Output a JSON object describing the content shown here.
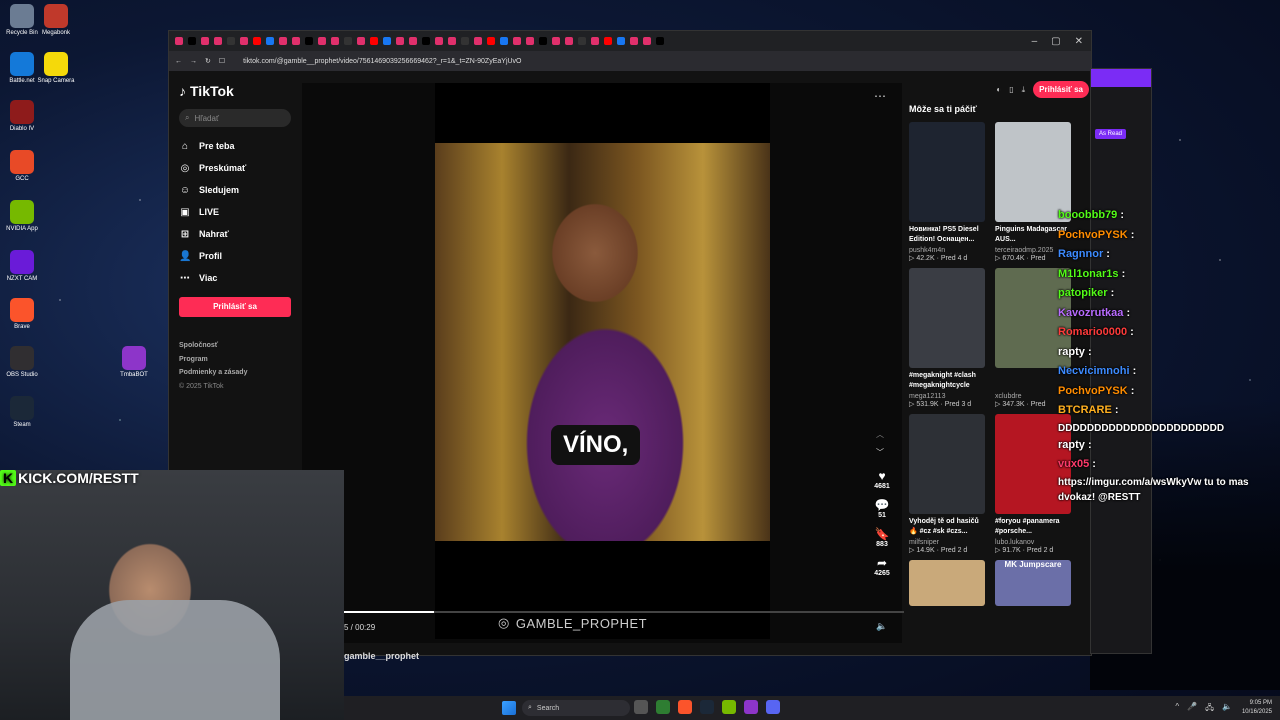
{
  "desktop": {
    "icons": [
      {
        "label": "Recycle Bin",
        "icon": "recycle-bin-icon",
        "color": "#6b7c93"
      },
      {
        "label": "Megabonk",
        "icon": "megabonk-icon",
        "color": "#c0392b"
      },
      {
        "label": "Battle.net",
        "icon": "battlenet-icon",
        "color": "#1479d9"
      },
      {
        "label": "Snap Camera",
        "icon": "snap-camera-icon",
        "color": "#f5d90a"
      },
      {
        "label": "Diablo IV",
        "icon": "diablo-icon",
        "color": "#8e1b1b"
      },
      {
        "label": "GCC",
        "icon": "gcc-icon",
        "color": "#e84a27"
      },
      {
        "label": "NVIDIA App",
        "icon": "nvidia-icon",
        "color": "#76b900"
      },
      {
        "label": "NZXT CAM",
        "icon": "nzxt-icon",
        "color": "#6a1bd8"
      },
      {
        "label": "Brave",
        "icon": "brave-icon",
        "color": "#fb542b"
      },
      {
        "label": "OBS Studio",
        "icon": "obs-icon",
        "color": "#302e31"
      },
      {
        "label": "Steam",
        "icon": "steam-icon",
        "color": "#1b2838"
      },
      {
        "label": "TmbaBOT",
        "icon": "tmbabot-icon",
        "color": "#8d35c9"
      }
    ]
  },
  "browser": {
    "url": "tiktok.com/@gamble__prophet/video/7561469039256669462?_r=1&_t=ZN-90ZyEaYjUvO",
    "window_controls": [
      "–",
      "▢",
      "✕"
    ]
  },
  "tiktok": {
    "brand": "TikTok",
    "search_placeholder": "Hľadať",
    "nav": [
      {
        "label": "Pre teba",
        "icon": "home-icon",
        "glyph": "⌂"
      },
      {
        "label": "Preskúmať",
        "icon": "compass-icon",
        "glyph": "◎"
      },
      {
        "label": "Sledujem",
        "icon": "following-icon",
        "glyph": "☺"
      },
      {
        "label": "LIVE",
        "icon": "live-icon",
        "glyph": "▣"
      },
      {
        "label": "Nahrať",
        "icon": "upload-icon",
        "glyph": "⊞"
      },
      {
        "label": "Profil",
        "icon": "profile-icon",
        "glyph": "👤"
      },
      {
        "label": "Viac",
        "icon": "more-icon",
        "glyph": "⋯"
      }
    ],
    "login_label": "Prihlásiť sa",
    "footer": {
      "links": [
        "Spoločnosť",
        "Program",
        "Podmienky a zásady"
      ],
      "copyright": "© 2025 TikTok"
    },
    "video": {
      "caption": "VÍNO,",
      "watermark": "GAMBLE_PROPHET",
      "time": "5 / 00:29",
      "progress": 0.16,
      "author": "gamble__prophet"
    },
    "actions": [
      {
        "icon": "heart-icon",
        "glyph": "♥",
        "count": "4681"
      },
      {
        "icon": "comment-icon",
        "glyph": "💬",
        "count": "51"
      },
      {
        "icon": "bookmark-icon",
        "glyph": "🔖",
        "count": "883"
      },
      {
        "icon": "share-icon",
        "glyph": "➦",
        "count": "4265"
      }
    ],
    "recommended": {
      "title": "Môže sa ti páčiť",
      "login_label": "Prihlásiť sa",
      "cards": [
        {
          "title": "Новинка! PS5 Diesel Edition! Оснащен...",
          "user": "pushk4m4n",
          "meta": "▷ 42.2K · Pred 4 d",
          "color": "#1e2430"
        },
        {
          "title": "Pinguins Madagascar AUS...",
          "user": "terceiraodmp.2025",
          "meta": "▷ 670.4K · Pred",
          "color": "#bfc4c8"
        },
        {
          "title": "#megaknight #clash #megaknightcycle",
          "user": "mega12113",
          "meta": "▷ 531.9K · Pred 3 d",
          "color": "#3a3d44"
        },
        {
          "title": "",
          "user": "xclubdre",
          "meta": "▷ 347.3K · Pred",
          "color": "#5f6b50"
        },
        {
          "title": "Vyhoděj tě od hasičů 🔥 #cz #sk #czs...",
          "user": "milfsniper",
          "meta": "▷ 14.9K · Pred 2 d",
          "color": "#2d3036"
        },
        {
          "title": "#foryou #panamera #porsche...",
          "user": "lubo.lukanov",
          "meta": "▷ 91.7K · Pred 2 d",
          "color": "#b51622"
        },
        {
          "title": "",
          "user": "",
          "meta": "",
          "color": "#c9a97a"
        },
        {
          "title": "MK Jumpscare",
          "user": "",
          "meta": "",
          "color": "#6b6fa8"
        }
      ]
    }
  },
  "chat": {
    "read_label": "As Read",
    "messages": [
      {
        "user": "booobbb79",
        "color": "#53fc18",
        "text": ""
      },
      {
        "user": "PochvoPYSK",
        "color": "#ff8c00",
        "text": ""
      },
      {
        "user": "Ragnnor",
        "color": "#3d8bff",
        "text": ""
      },
      {
        "user": "M1l1onar1s",
        "color": "#53fc18",
        "text": ""
      },
      {
        "user": "patopiker",
        "color": "#53fc18",
        "text": ""
      },
      {
        "user": "Kavozrutkaa",
        "color": "#b86bff",
        "text": ""
      },
      {
        "user": "Romario0000",
        "color": "#ff3b3b",
        "text": ""
      },
      {
        "user": "rapty",
        "color": "#ffffff",
        "text": ""
      },
      {
        "user": "Necvicimnohi",
        "color": "#3d8bff",
        "text": ""
      },
      {
        "user": "PochvoPYSK",
        "color": "#ff8c00",
        "text": ""
      },
      {
        "user": "BTCRARE",
        "color": "#ffb020",
        "text": "DDDDDDDDDDDDDDDDDDDDDDD"
      },
      {
        "user": "rapty",
        "color": "#ffffff",
        "text": ""
      },
      {
        "user": "vux05",
        "color": "#ff3b6b",
        "text": "https://imgur.com/a/wsWkyVw tu to mas dvokaz! @RESTT"
      }
    ]
  },
  "stream": {
    "kick_label": "KICK.COM/RESTT"
  },
  "taskbar": {
    "search_placeholder": "Search",
    "time": "9:05 PM",
    "date": "10/16/2025"
  }
}
